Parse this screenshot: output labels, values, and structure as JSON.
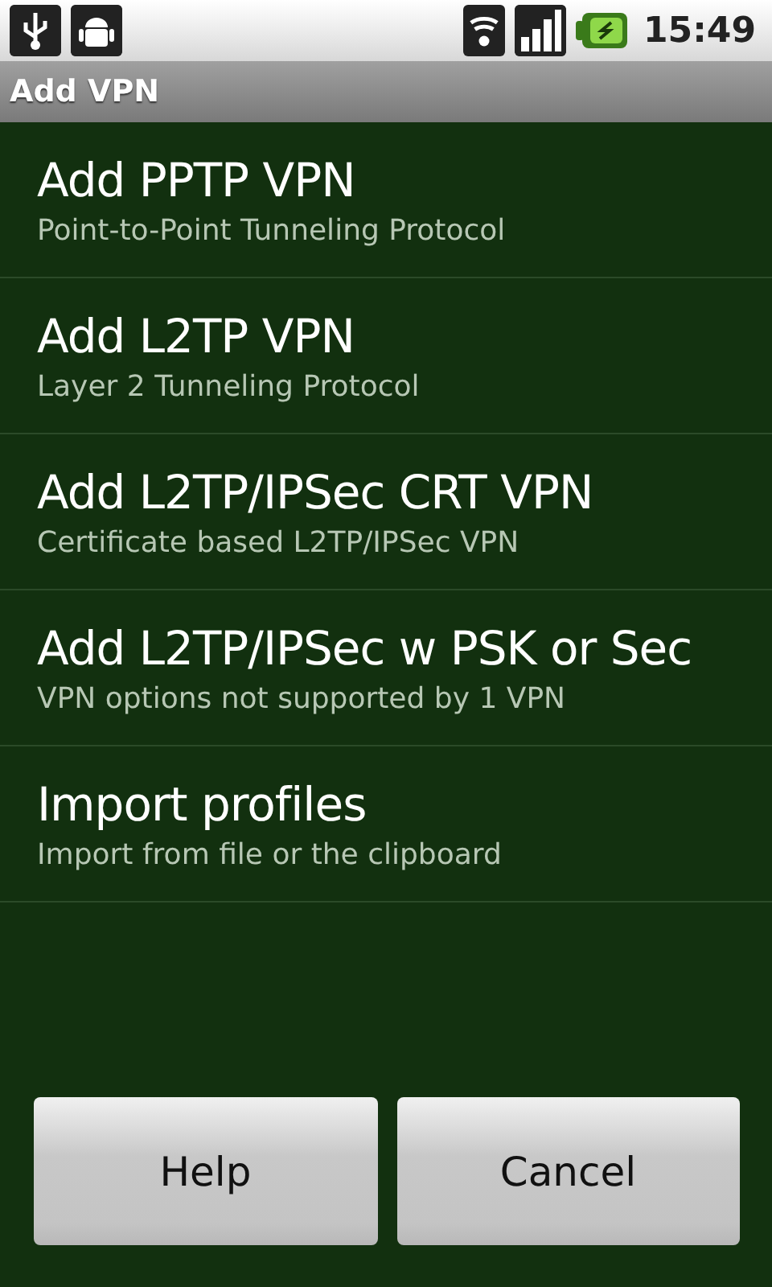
{
  "status_bar": {
    "time": "15:49"
  },
  "title_bar": {
    "title": "Add VPN"
  },
  "items": [
    {
      "title": "Add PPTP VPN",
      "subtitle": "Point-to-Point Tunneling Protocol"
    },
    {
      "title": "Add L2TP VPN",
      "subtitle": "Layer 2 Tunneling Protocol"
    },
    {
      "title": "Add L2TP/IPSec CRT VPN",
      "subtitle": "Certificate based L2TP/IPSec VPN"
    },
    {
      "title": "Add L2TP/IPSec w PSK or Sec",
      "subtitle": "VPN options not supported by 1 VPN"
    },
    {
      "title": "Import profiles",
      "subtitle": "Import from file or the clipboard"
    }
  ],
  "buttons": [
    "Help",
    "Cancel"
  ]
}
